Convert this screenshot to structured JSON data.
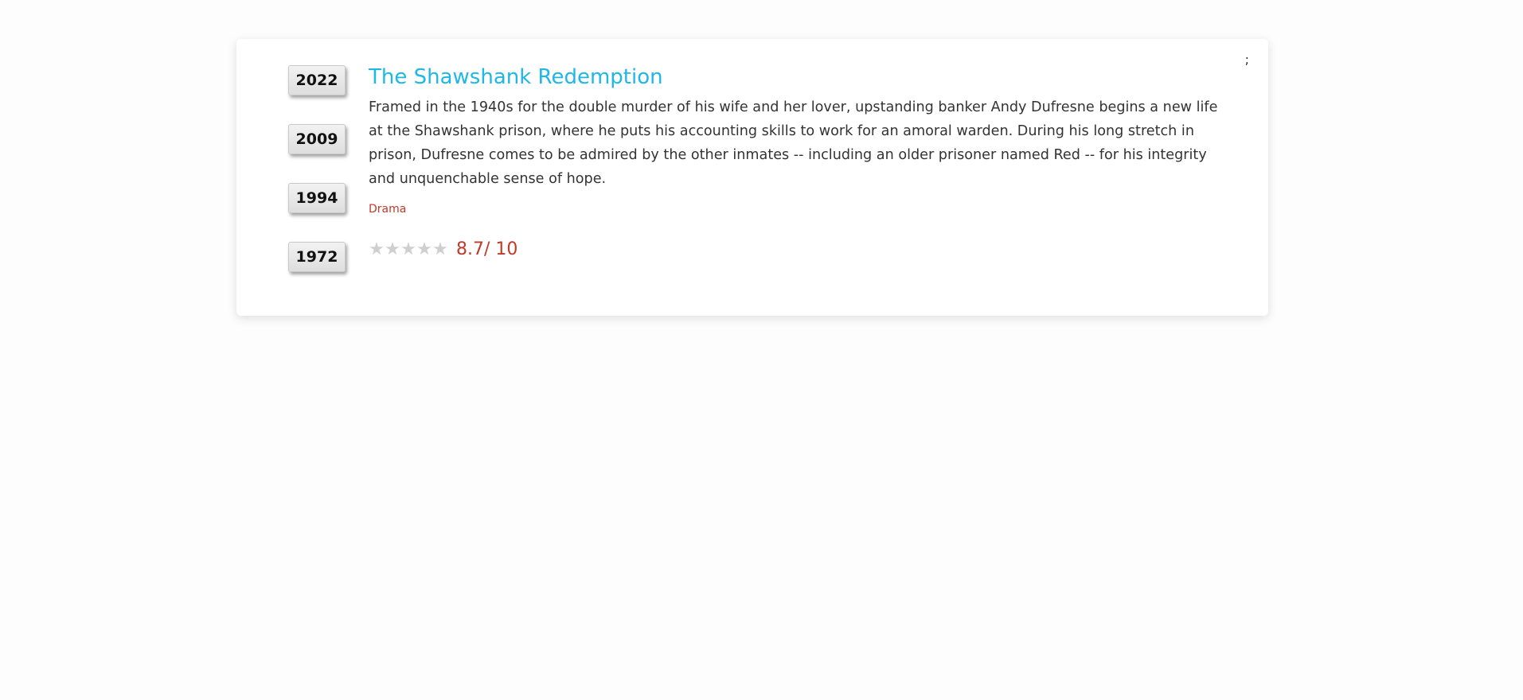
{
  "years": [
    "2022",
    "2009",
    "1994",
    "1972"
  ],
  "movie": {
    "title": "The Shawshank Redemption",
    "description": "Framed in the 1940s for the double murder of his wife and her lover, upstanding banker Andy Dufresne begins a new life at the Shawshank prison, where he puts his accounting skills to work for an amoral warden. During his long stretch in prison, Dufresne comes to be admired by the other inmates -- including an older prisoner named Red -- for his integrity and unquenchable sense of hope.",
    "genre": "Drama",
    "rating_text": "8.7/ 10",
    "stars_filled": 0,
    "stars_total": 5
  },
  "menu": {
    "icon_text": ";"
  },
  "colors": {
    "title": "#1fb8e6",
    "accent": "#c0392b",
    "star_empty": "#cfcfcf"
  },
  "icons": {
    "star": "star-icon",
    "menu": "more-icon"
  }
}
